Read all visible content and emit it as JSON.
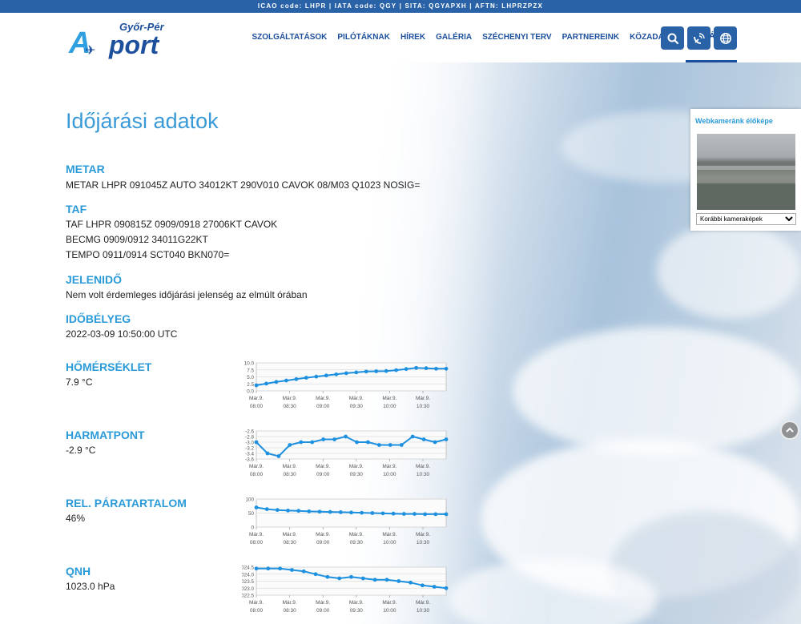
{
  "topbar": "ICAO code: LHPR | IATA code: QGY | SITA: QGYAPXH | AFTN: LHPRZPZX",
  "logo": {
    "small": "Győr-Pér",
    "a": "A",
    "rest": "port"
  },
  "nav": [
    {
      "label": "SZOLGÁLTATÁSOK"
    },
    {
      "label": "PILÓTÁKNAK"
    },
    {
      "label": "HÍREK"
    },
    {
      "label": "GALÉRIA"
    },
    {
      "label": "SZÉCHENYI TERV"
    },
    {
      "label": "PARTNEREINK"
    },
    {
      "label": "KÖZADATOK"
    },
    {
      "label": "IDŐJÁRÁS",
      "active": true
    }
  ],
  "page_title": "Időjárási adatok",
  "metar": {
    "title": "METAR",
    "text": "METAR LHPR 091045Z AUTO 34012KT 290V010 CAVOK 08/M03 Q1023 NOSIG="
  },
  "taf": {
    "title": "TAF",
    "lines": [
      "TAF LHPR 090815Z 0909/0918 27006KT CAVOK",
      "BECMG 0909/0912 34011G22KT",
      "TEMPO 0911/0914 SCT040 BKN070="
    ]
  },
  "jelenido": {
    "title": "JELENIDŐ",
    "text": "Nem volt érdemleges időjárási jelenség az elmúlt órában"
  },
  "idobelyeg": {
    "title": "IDŐBÉLYEG",
    "text": "2022-03-09 10:50:00 UTC"
  },
  "homerseklet": {
    "title": "HŐMÉRSÉKLET",
    "value": "7.9 °C"
  },
  "harmatpont": {
    "title": "HARMATPONT",
    "value": "-2.9 °C"
  },
  "paratartalom": {
    "title": "REL. PÁRATARTALOM",
    "value": "46%"
  },
  "qnh": {
    "title": "QNH",
    "value": "1023.0 hPa"
  },
  "webcam": {
    "title": "Webkameránk élőképe",
    "select_value": "Korábbi kameraképek"
  },
  "chart_data": [
    {
      "type": "line",
      "ticks_x": [
        "Már.9.\n08:00",
        "Már.9.\n08:30",
        "Már.9.\n09:00",
        "Már.9.\n09:30",
        "Már.9.\n10:00",
        "Már.9.\n10:30"
      ],
      "yticks": [
        "10.0",
        "7.5",
        "5.0",
        "2.5",
        "0.0"
      ],
      "ylim": [
        0,
        10
      ],
      "values": [
        2.0,
        2.6,
        3.2,
        3.7,
        4.2,
        4.7,
        5.1,
        5.5,
        5.9,
        6.3,
        6.6,
        6.9,
        7.0,
        7.1,
        7.4,
        7.8,
        8.2,
        8.1,
        7.9,
        7.9
      ]
    },
    {
      "type": "line",
      "ticks_x": [
        "Már.9.\n08:00",
        "Már.9.\n08:30",
        "Már.9.\n09:00",
        "Már.9.\n09:30",
        "Már.9.\n10:00",
        "Már.9.\n10:30"
      ],
      "yticks": [
        "-2.6",
        "-2.8",
        "-3.0",
        "-3.2",
        "-3.4",
        "-3.6"
      ],
      "ylim": [
        -3.6,
        -2.6
      ],
      "values": [
        -3.0,
        -3.4,
        -3.5,
        -3.1,
        -3.0,
        -3.0,
        -2.9,
        -2.9,
        -2.8,
        -3.0,
        -3.0,
        -3.1,
        -3.1,
        -3.1,
        -2.8,
        -2.9,
        -3.0,
        -2.9
      ]
    },
    {
      "type": "line",
      "ticks_x": [
        "Már.9.\n08:00",
        "Már.9.\n08:30",
        "Már.9.\n09:00",
        "Már.9.\n09:30",
        "Már.9.\n10:00",
        "Már.9.\n10:30"
      ],
      "yticks": [
        "100",
        "50",
        "0"
      ],
      "ylim": [
        0,
        100
      ],
      "values": [
        70,
        64,
        61,
        59,
        58,
        56,
        55,
        54,
        53,
        52,
        51,
        50,
        49,
        48,
        47,
        47,
        46,
        46,
        46
      ]
    },
    {
      "type": "line",
      "ticks_x": [
        "Már.9.\n08:00",
        "Már.9.\n08:30",
        "Már.9.\n09:00",
        "Már.9.\n09:30",
        "Már.9.\n10:00",
        "Már.9.\n10:30"
      ],
      "yticks": [
        "1024.5",
        "1024.0",
        "1023.5",
        "1023.0",
        "1022.5"
      ],
      "ylim": [
        1022.5,
        1024.5
      ],
      "values": [
        1024.4,
        1024.4,
        1024.4,
        1024.3,
        1024.2,
        1024.0,
        1023.8,
        1023.7,
        1023.8,
        1023.7,
        1023.6,
        1023.6,
        1023.5,
        1023.4,
        1023.2,
        1023.1,
        1023.0
      ]
    }
  ]
}
